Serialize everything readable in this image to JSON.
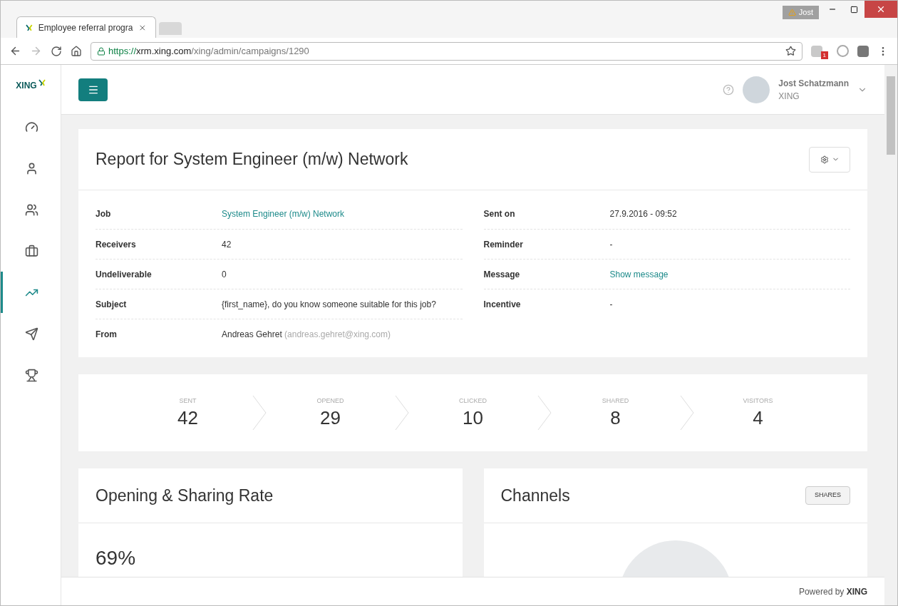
{
  "browser": {
    "profile": "Jost",
    "tab_title": "Employee referral progra",
    "url": {
      "scheme": "https://",
      "host": "xrm.xing.com",
      "path": "/xing/admin/campaigns/1290"
    },
    "extension_badge": "1"
  },
  "sidebar": {
    "logo": "XING",
    "items": [
      {
        "selected": false
      },
      {
        "selected": false
      },
      {
        "selected": false
      },
      {
        "selected": false
      },
      {
        "selected": true
      },
      {
        "selected": false
      },
      {
        "selected": false
      }
    ]
  },
  "header": {
    "user_name": "Jost Schatzmann",
    "company": "XING"
  },
  "report": {
    "title": "Report for System Engineer (m/w) Network",
    "left": [
      {
        "label": "Job",
        "value": "System Engineer (m/w) Network",
        "kind": "link"
      },
      {
        "label": "Receivers",
        "value": "42",
        "kind": "text"
      },
      {
        "label": "Undeliverable",
        "value": "0",
        "kind": "text"
      },
      {
        "label": "Subject",
        "value": "{first_name}, do you know someone suitable for this job?",
        "kind": "text"
      },
      {
        "label": "From",
        "value": "Andreas Gehret",
        "note": "(andreas.gehret@xing.com)",
        "kind": "text"
      }
    ],
    "right": [
      {
        "label": "Sent on",
        "value": "27.9.2016 - 09:52",
        "kind": "text"
      },
      {
        "label": "Reminder",
        "value": "-",
        "kind": "text"
      },
      {
        "label": "Message",
        "value": "Show message",
        "kind": "link"
      },
      {
        "label": "Incentive",
        "value": "-",
        "kind": "text"
      }
    ]
  },
  "funnel": [
    {
      "label": "SENT",
      "value": "42"
    },
    {
      "label": "OPENED",
      "value": "29"
    },
    {
      "label": "CLICKED",
      "value": "10"
    },
    {
      "label": "SHARED",
      "value": "8"
    },
    {
      "label": "VISITORS",
      "value": "4"
    }
  ],
  "rate_card": {
    "title": "Opening & Sharing Rate",
    "value": "69%"
  },
  "channels_card": {
    "title": "Channels",
    "button": "SHARES"
  },
  "footer": {
    "prefix": "Powered by",
    "brand": "XING"
  }
}
